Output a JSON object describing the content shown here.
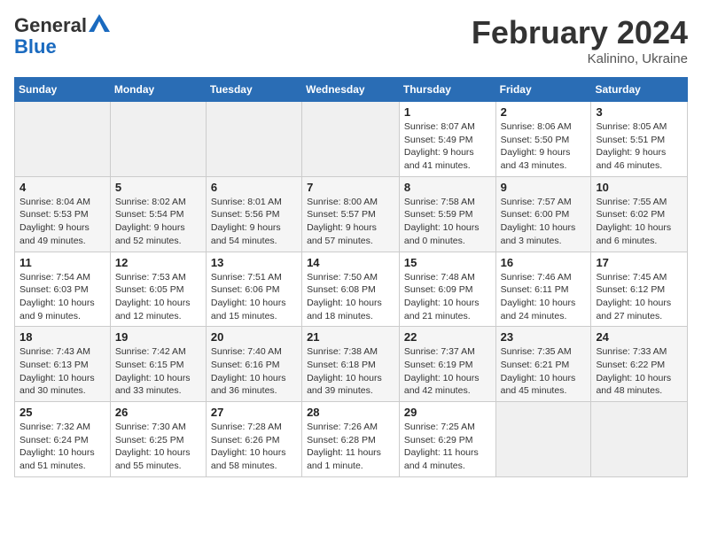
{
  "header": {
    "logo_line1": "General",
    "logo_line2": "Blue",
    "month_title": "February 2024",
    "subtitle": "Kalinino, Ukraine"
  },
  "days_of_week": [
    "Sunday",
    "Monday",
    "Tuesday",
    "Wednesday",
    "Thursday",
    "Friday",
    "Saturday"
  ],
  "weeks": [
    [
      {
        "day": "",
        "info": ""
      },
      {
        "day": "",
        "info": ""
      },
      {
        "day": "",
        "info": ""
      },
      {
        "day": "",
        "info": ""
      },
      {
        "day": "1",
        "info": "Sunrise: 8:07 AM\nSunset: 5:49 PM\nDaylight: 9 hours\nand 41 minutes."
      },
      {
        "day": "2",
        "info": "Sunrise: 8:06 AM\nSunset: 5:50 PM\nDaylight: 9 hours\nand 43 minutes."
      },
      {
        "day": "3",
        "info": "Sunrise: 8:05 AM\nSunset: 5:51 PM\nDaylight: 9 hours\nand 46 minutes."
      }
    ],
    [
      {
        "day": "4",
        "info": "Sunrise: 8:04 AM\nSunset: 5:53 PM\nDaylight: 9 hours\nand 49 minutes."
      },
      {
        "day": "5",
        "info": "Sunrise: 8:02 AM\nSunset: 5:54 PM\nDaylight: 9 hours\nand 52 minutes."
      },
      {
        "day": "6",
        "info": "Sunrise: 8:01 AM\nSunset: 5:56 PM\nDaylight: 9 hours\nand 54 minutes."
      },
      {
        "day": "7",
        "info": "Sunrise: 8:00 AM\nSunset: 5:57 PM\nDaylight: 9 hours\nand 57 minutes."
      },
      {
        "day": "8",
        "info": "Sunrise: 7:58 AM\nSunset: 5:59 PM\nDaylight: 10 hours\nand 0 minutes."
      },
      {
        "day": "9",
        "info": "Sunrise: 7:57 AM\nSunset: 6:00 PM\nDaylight: 10 hours\nand 3 minutes."
      },
      {
        "day": "10",
        "info": "Sunrise: 7:55 AM\nSunset: 6:02 PM\nDaylight: 10 hours\nand 6 minutes."
      }
    ],
    [
      {
        "day": "11",
        "info": "Sunrise: 7:54 AM\nSunset: 6:03 PM\nDaylight: 10 hours\nand 9 minutes."
      },
      {
        "day": "12",
        "info": "Sunrise: 7:53 AM\nSunset: 6:05 PM\nDaylight: 10 hours\nand 12 minutes."
      },
      {
        "day": "13",
        "info": "Sunrise: 7:51 AM\nSunset: 6:06 PM\nDaylight: 10 hours\nand 15 minutes."
      },
      {
        "day": "14",
        "info": "Sunrise: 7:50 AM\nSunset: 6:08 PM\nDaylight: 10 hours\nand 18 minutes."
      },
      {
        "day": "15",
        "info": "Sunrise: 7:48 AM\nSunset: 6:09 PM\nDaylight: 10 hours\nand 21 minutes."
      },
      {
        "day": "16",
        "info": "Sunrise: 7:46 AM\nSunset: 6:11 PM\nDaylight: 10 hours\nand 24 minutes."
      },
      {
        "day": "17",
        "info": "Sunrise: 7:45 AM\nSunset: 6:12 PM\nDaylight: 10 hours\nand 27 minutes."
      }
    ],
    [
      {
        "day": "18",
        "info": "Sunrise: 7:43 AM\nSunset: 6:13 PM\nDaylight: 10 hours\nand 30 minutes."
      },
      {
        "day": "19",
        "info": "Sunrise: 7:42 AM\nSunset: 6:15 PM\nDaylight: 10 hours\nand 33 minutes."
      },
      {
        "day": "20",
        "info": "Sunrise: 7:40 AM\nSunset: 6:16 PM\nDaylight: 10 hours\nand 36 minutes."
      },
      {
        "day": "21",
        "info": "Sunrise: 7:38 AM\nSunset: 6:18 PM\nDaylight: 10 hours\nand 39 minutes."
      },
      {
        "day": "22",
        "info": "Sunrise: 7:37 AM\nSunset: 6:19 PM\nDaylight: 10 hours\nand 42 minutes."
      },
      {
        "day": "23",
        "info": "Sunrise: 7:35 AM\nSunset: 6:21 PM\nDaylight: 10 hours\nand 45 minutes."
      },
      {
        "day": "24",
        "info": "Sunrise: 7:33 AM\nSunset: 6:22 PM\nDaylight: 10 hours\nand 48 minutes."
      }
    ],
    [
      {
        "day": "25",
        "info": "Sunrise: 7:32 AM\nSunset: 6:24 PM\nDaylight: 10 hours\nand 51 minutes."
      },
      {
        "day": "26",
        "info": "Sunrise: 7:30 AM\nSunset: 6:25 PM\nDaylight: 10 hours\nand 55 minutes."
      },
      {
        "day": "27",
        "info": "Sunrise: 7:28 AM\nSunset: 6:26 PM\nDaylight: 10 hours\nand 58 minutes."
      },
      {
        "day": "28",
        "info": "Sunrise: 7:26 AM\nSunset: 6:28 PM\nDaylight: 11 hours\nand 1 minute."
      },
      {
        "day": "29",
        "info": "Sunrise: 7:25 AM\nSunset: 6:29 PM\nDaylight: 11 hours\nand 4 minutes."
      },
      {
        "day": "",
        "info": ""
      },
      {
        "day": "",
        "info": ""
      }
    ]
  ]
}
